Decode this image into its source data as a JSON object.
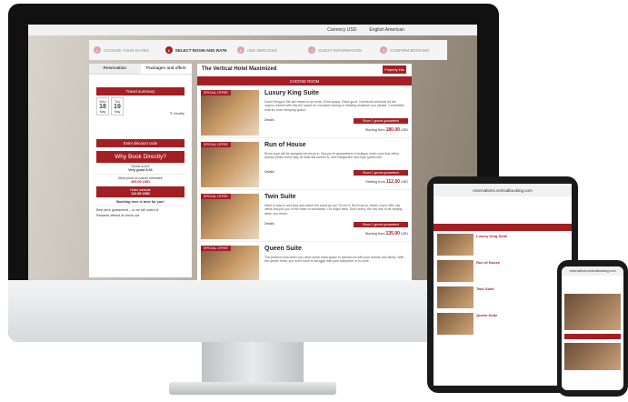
{
  "topbar": {
    "currency": "Currency USD",
    "language": "English American"
  },
  "steps": [
    {
      "num": "1",
      "label": "CHOOSE YOUR DATES"
    },
    {
      "num": "2",
      "label": "SELECT ROOM AND RATE"
    },
    {
      "num": "3",
      "label": "ADD SERVICES"
    },
    {
      "num": "4",
      "label": "GUEST INFORMATION"
    },
    {
      "num": "5",
      "label": "CONFIRM BOOKING"
    }
  ],
  "left": {
    "tabs": [
      "Reservation",
      "Packages and offers"
    ],
    "travel_summary": "Travel summary",
    "date_in": {
      "dow": "Wed",
      "day": "18",
      "mon": "May"
    },
    "date_out": {
      "dow": "Thu",
      "day": "19",
      "mon": "May"
    },
    "modify": "Modify",
    "discount": "Enter discount code",
    "why_title": "Why Book Directly?",
    "guest_score_label": "Guest score",
    "guest_score": "Very good 8.01",
    "best_price_label": "Best price on travel websites",
    "best_price": "359.00 USD",
    "hotel_label": "Hotel website",
    "hotel_price": "112.50 USD",
    "booking_here": "Booking here is best for you!",
    "note": "Best price guaranteed – or we will match it!",
    "rewards": "Rewards offered at check-out"
  },
  "right": {
    "hotel_name": "The Vertical Hotel Maximized",
    "property_info": "Property info",
    "choose_room": "CHOOSE ROOM",
    "rooms": [
      {
        "tag": "SPECIAL OFFER",
        "name": "Luxury King Suite",
        "desc": "Some things in life are meant to be extra. Extra space. Extra good. Oversized windows let the vapour unwind with city the space for constant moving or relaxing whatever you please. Convertible sofa for more sleeping space.",
        "details": "Details",
        "rate": "Room 1 guests guaranteed",
        "price_label": "Starting from",
        "price": "180.00",
        "currency": "USD"
      },
      {
        "tag": "SPECIAL OFFER",
        "name": "Run of House",
        "desc": "Room type will be assigned at check-in. But you're guaranteed a boutique hotel room that offers special perks every stay. At least flat screen tv, mini refrigerator and high speed wifi.",
        "details": "Details",
        "rate": "Room 1 guests guaranteed",
        "price_label": "Starting from",
        "price": "112.50",
        "currency": "USD"
      },
      {
        "tag": "SPECIAL OFFER",
        "name": "Twin Suite",
        "desc": "Want to stay in and stay and watch the world go by? Go for it. But trust us, these rooms offer city views and put you in the heart of downtown. Let major sites. Don't worry, the city has to be waiting when you return.",
        "details": "Details",
        "rate": "Room 1 guests guaranteed",
        "price_label": "Starting from",
        "price": "135.00",
        "currency": "USD"
      },
      {
        "tag": "SPECIAL OFFER",
        "name": "Queen Suite",
        "desc": "The perfect room when you need some extra space to spread out with your friends and family. With two queen beds, you won't have to struggle with your sleepover or to work.",
        "details": "Details",
        "rate": "",
        "price_label": "",
        "price": "",
        "currency": ""
      }
    ]
  },
  "tablet": {
    "url": "reservations.verticalbooking.com",
    "r1": "Luxury King Suite",
    "r2": "Run of House",
    "r3": "Twin Suite",
    "r4": "Queen Suite"
  },
  "phone": {
    "url": "reservations.verticalbooking.com"
  }
}
